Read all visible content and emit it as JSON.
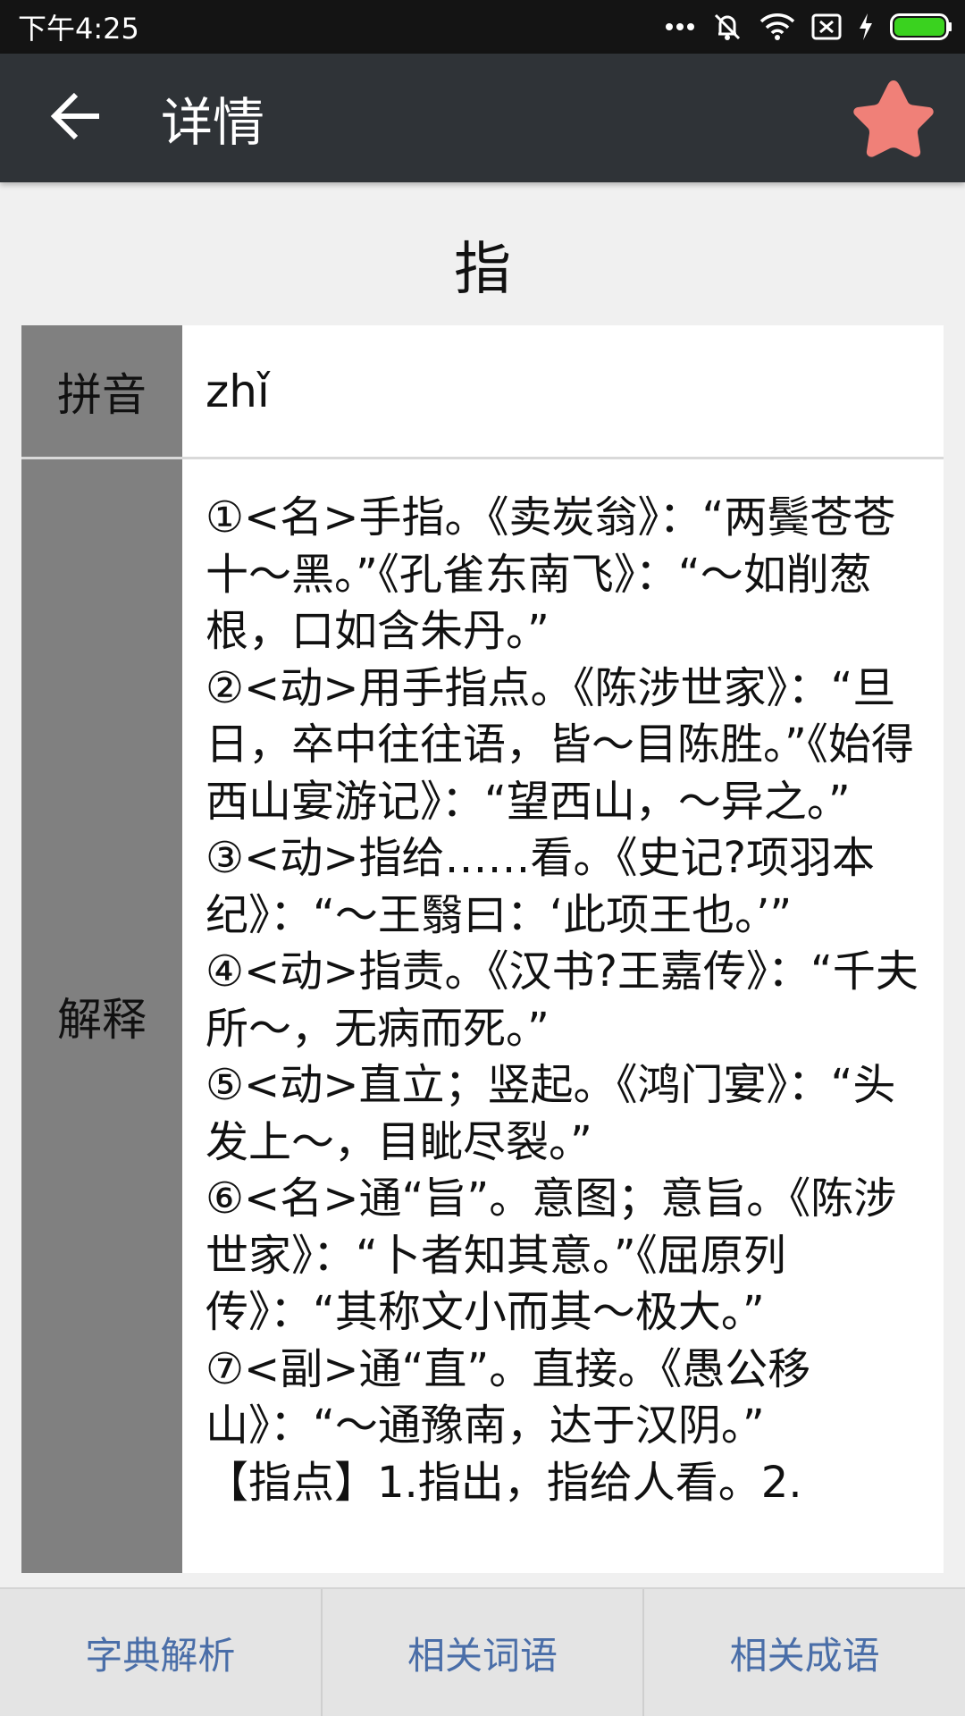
{
  "status_bar": {
    "time": "下午4:25",
    "icons": [
      "more-dots-icon",
      "mute-icon",
      "wifi-icon",
      "sim-icon",
      "charging-icon",
      "battery-icon"
    ],
    "battery_color": "#3ad21f"
  },
  "app_bar": {
    "title": "详情",
    "back_icon": "arrow-left-icon",
    "favorite_icon": "star-icon",
    "favorite_color": "#f08078"
  },
  "word": "指",
  "pinyin": {
    "label": "拼音",
    "value": "zhǐ"
  },
  "definition": {
    "label": "解释",
    "text": "①<名>手指。《卖炭翁》：“两鬓苍苍十～黑。”《孔雀东南飞》：“～如削葱根，口如含朱丹。”\n②<动>用手指点。《陈涉世家》：“旦日，卒中往往语，皆～目陈胜。”《始得西山宴游记》：“望西山，～异之。”\n③<动>指给……看。《史记?项羽本纪》：“～王翳曰：‘此项王也。’”\n④<动>指责。《汉书?王嘉传》：“千夫所～，无病而死。”\n⑤<动>直立；竖起。《鸿门宴》：“头发上～，目眦尽裂。”\n⑥<名>通“旨”。意图；意旨。《陈涉世家》：“卜者知其意。”《屈原列传》：“其称文小而其～极大。”\n⑦<副>通“直”。直接。《愚公移山》：“～通豫南，达于汉阴。”\n【指点】1.指出，指给人看。2."
  },
  "bottom_tabs": [
    {
      "label": "字典解析"
    },
    {
      "label": "相关词语"
    },
    {
      "label": "相关成语"
    }
  ],
  "colors": {
    "app_bar": "#2f3337",
    "label_cell": "#808080",
    "tab_text": "#4a6ea8"
  }
}
